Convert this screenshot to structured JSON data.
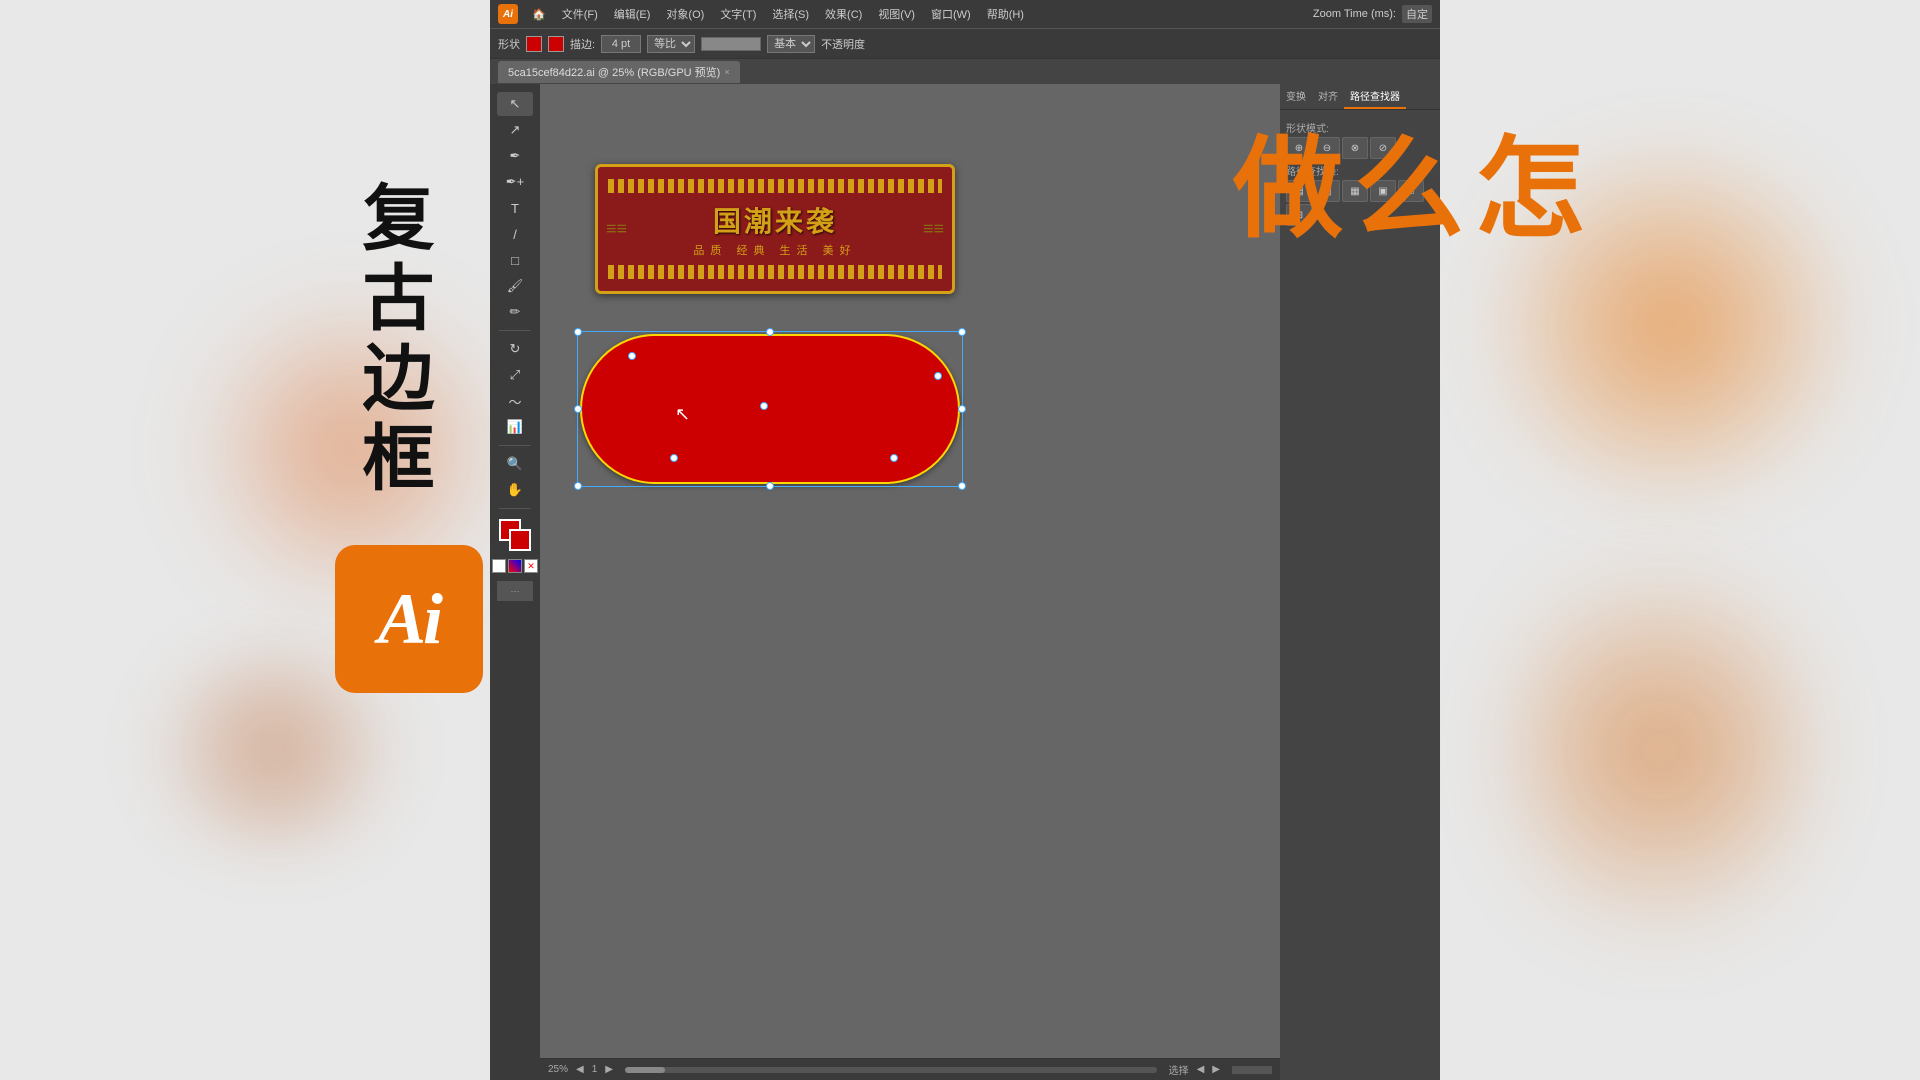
{
  "app": {
    "title": "Adobe Illustrator",
    "logo_text": "Ai",
    "tab_filename": "5ca15cef84d22.ai @ 25% (RGB/GPU 预览)",
    "zoom_level": "25%",
    "zoom_time_label": "Zoom Time (ms):",
    "zoom_time_value": "自定",
    "page_number": "1",
    "status_text": "选择",
    "close_label": "×"
  },
  "menu": {
    "items": [
      "文件(F)",
      "编辑(E)",
      "对象(O)",
      "文字(T)",
      "选择(S)",
      "效果(C)",
      "视图(V)",
      "窗口(W)",
      "帮助(H)"
    ]
  },
  "toolbar": {
    "fill_color": "#cc0000",
    "stroke_color": "#cc0000",
    "stroke_width": "4 pt",
    "stroke_align_label": "等比",
    "opacity_label": "基本"
  },
  "panel": {
    "tabs": [
      "变换",
      "对齐",
      "路径查找器"
    ],
    "shape_mode_label": "形状模式:",
    "pathfinder_label": "路径查找操:"
  },
  "left_text": {
    "chars": [
      "复",
      "古",
      "边",
      "框"
    ],
    "full": "复古边框"
  },
  "right_text": {
    "chars": [
      "怎",
      "么",
      "做"
    ],
    "full": "怎么做"
  },
  "ai_logo": {
    "text": "Ai",
    "bg_color": "#e8710a"
  },
  "sign": {
    "main_text": "国潮来袭",
    "sub_text": "品质 经典 生活 美好"
  },
  "canvas": {
    "zoom": "25%"
  }
}
